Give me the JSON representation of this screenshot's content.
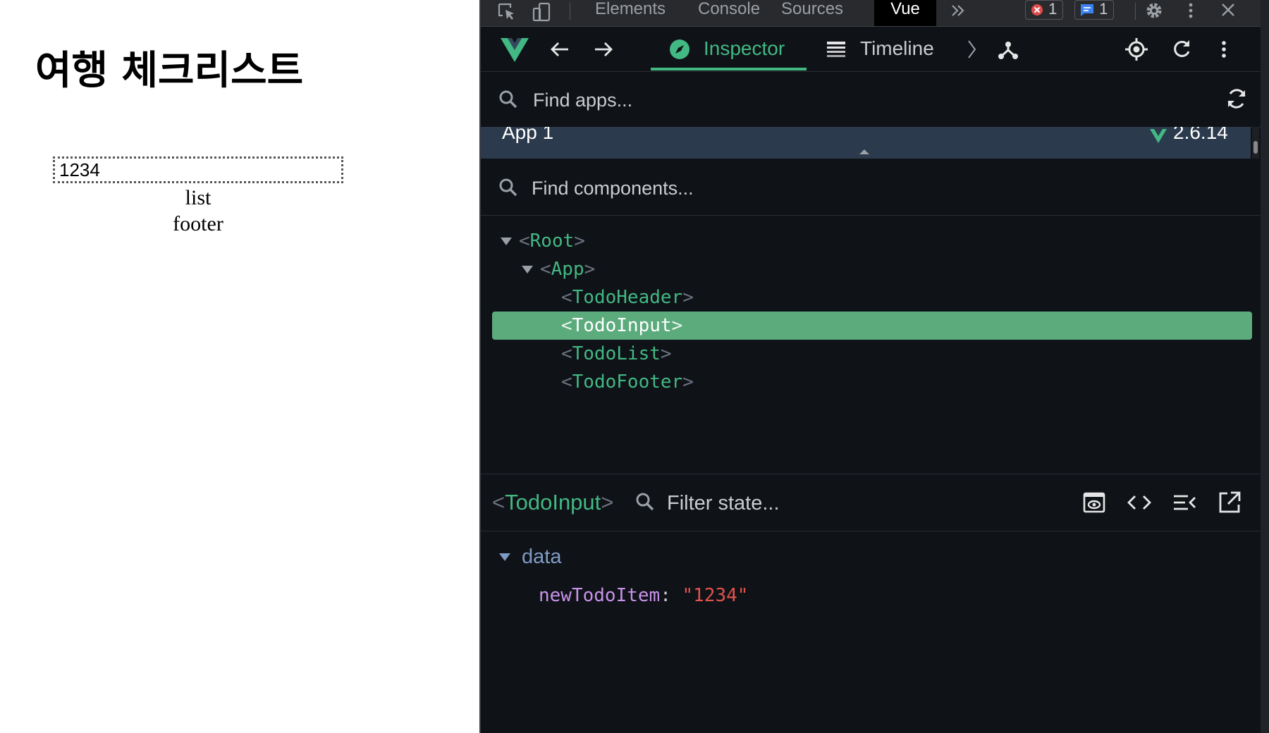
{
  "page": {
    "title": "여행 체크리스트",
    "input_value": "1234",
    "list_text": "list",
    "footer_text": "footer"
  },
  "devtools": {
    "tabs": [
      "Elements",
      "Console",
      "Sources",
      "Vue"
    ],
    "active_tab": "Vue",
    "more_tabs_icon": "double-chevron-right-icon",
    "error_count": "1",
    "message_count": "1",
    "vue_toolbar": {
      "inspector_label": "Inspector",
      "timeline_label": "Timeline"
    },
    "find_apps_placeholder": "Find apps...",
    "app": {
      "name": "App 1",
      "version": "2.6.14"
    },
    "find_components_placeholder": "Find components...",
    "tree": [
      {
        "name": "Root",
        "expanded": true
      },
      {
        "name": "App",
        "expanded": true
      },
      {
        "name": "TodoHeader"
      },
      {
        "name": "TodoInput",
        "selected": true
      },
      {
        "name": "TodoList"
      },
      {
        "name": "TodoFooter"
      }
    ],
    "state": {
      "component_name": "TodoInput",
      "filter_placeholder": "Filter state...",
      "section": "data",
      "field_key": "newTodoItem",
      "field_value": "\"1234\""
    },
    "colors": {
      "vue_green": "#42b883",
      "selected_row": "#5cab7d",
      "panel_bg": "#0f1217",
      "app_row_bg": "#2c3a4d",
      "key_color": "#c792ea",
      "string_color": "#e0524d"
    }
  }
}
